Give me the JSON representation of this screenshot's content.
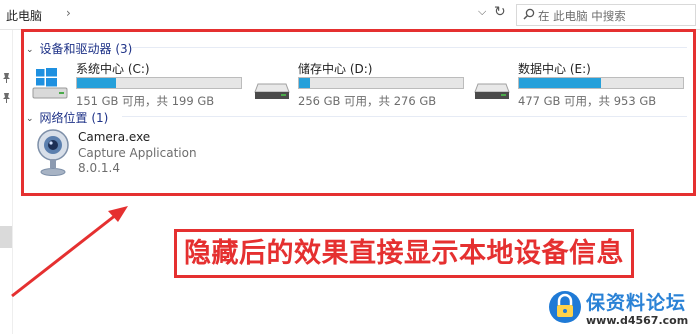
{
  "address": {
    "breadcrumb": "此电脑",
    "search_placeholder": "在 此电脑 中搜索"
  },
  "groups": {
    "devices_header": "设备和驱动器 (3)",
    "network_header": "网络位置 (1)"
  },
  "drives": [
    {
      "name": "系统中心 (C:)",
      "free_text": "151 GB 可用，共 199 GB",
      "used_fraction": 0.24
    },
    {
      "name": "储存中心 (D:)",
      "free_text": "256 GB 可用，共 276 GB",
      "used_fraction": 0.07
    },
    {
      "name": "数据中心 (E:)",
      "free_text": "477 GB 可用，共 953 GB",
      "used_fraction": 0.5
    }
  ],
  "network_item": {
    "name": "Camera.exe",
    "description": "Capture Application",
    "version": "8.0.1.4"
  },
  "annotation": {
    "callout": "隐藏后的效果直接显示本地设备信息"
  },
  "watermark": {
    "title": "保资料论坛",
    "url": "www.d4567.com"
  },
  "colors": {
    "accent_red": "#e53030",
    "drive_fill": "#26a0da",
    "group_header": "#1e3287"
  }
}
